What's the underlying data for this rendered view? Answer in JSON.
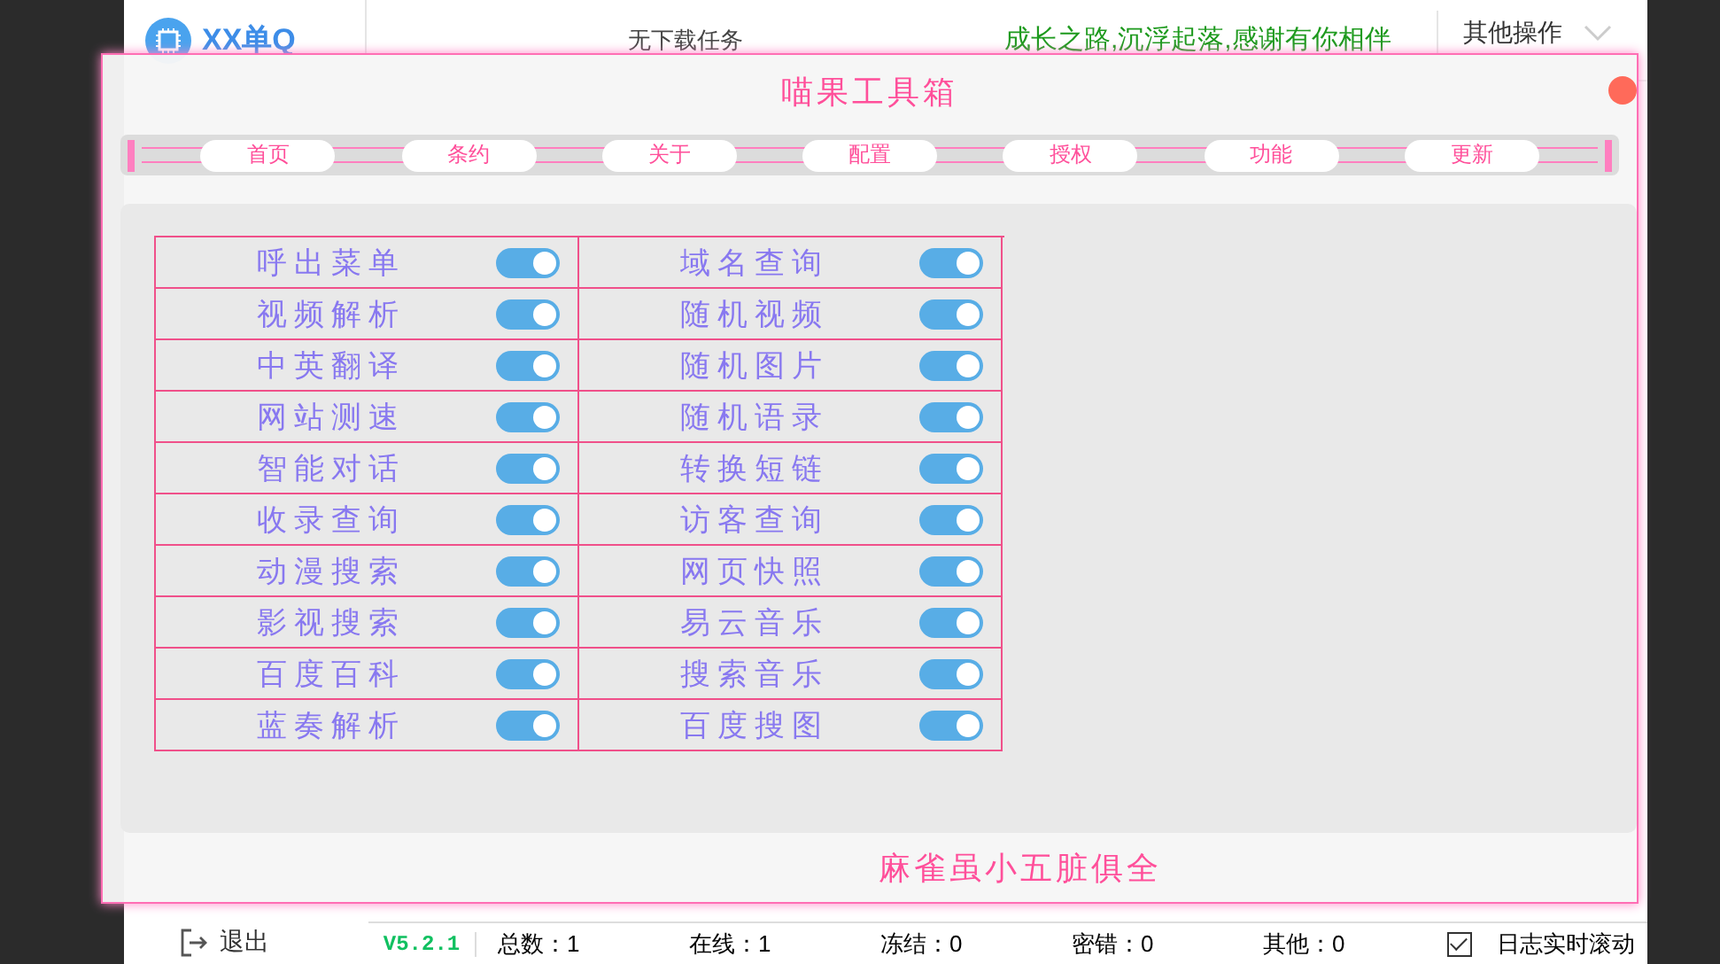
{
  "app": {
    "logo_text": "XX单Q",
    "download_status": "无下载任务",
    "motto": "成长之路,沉浮起落,感谢有你相伴",
    "menu": "其他操作",
    "exit": "退出"
  },
  "dialog": {
    "title": "喵果工具箱",
    "tabs": [
      {
        "label": "首页"
      },
      {
        "label": "条约"
      },
      {
        "label": "关于"
      },
      {
        "label": "配置"
      },
      {
        "label": "授权"
      },
      {
        "label": "功能"
      },
      {
        "label": "更新"
      }
    ],
    "switches": [
      {
        "name": "呼出菜单",
        "on": true
      },
      {
        "name": "域名查询",
        "on": true
      },
      {
        "name": "视频解析",
        "on": true
      },
      {
        "name": "随机视频",
        "on": true
      },
      {
        "name": "中英翻译",
        "on": true
      },
      {
        "name": "随机图片",
        "on": true
      },
      {
        "name": "网站测速",
        "on": true
      },
      {
        "name": "随机语录",
        "on": true
      },
      {
        "name": "智能对话",
        "on": true
      },
      {
        "name": "转换短链",
        "on": true
      },
      {
        "name": "收录查询",
        "on": true
      },
      {
        "name": "访客查询",
        "on": true
      },
      {
        "name": "动漫搜索",
        "on": true
      },
      {
        "name": "网页快照",
        "on": true
      },
      {
        "name": "影视搜索",
        "on": true
      },
      {
        "name": "易云音乐",
        "on": true
      },
      {
        "name": "百度百科",
        "on": true
      },
      {
        "name": "搜索音乐",
        "on": true
      },
      {
        "name": "蓝奏解析",
        "on": true
      },
      {
        "name": "百度搜图",
        "on": true
      }
    ],
    "footer": "麻雀虽小五脏俱全"
  },
  "status_bar": {
    "version": "V5.2.1",
    "stats": [
      "总数：1",
      "在线：1",
      "冻结：0",
      "密错：0",
      "其他：0"
    ],
    "autoscroll": {
      "label": "日志实时滚动",
      "checked": true
    }
  }
}
